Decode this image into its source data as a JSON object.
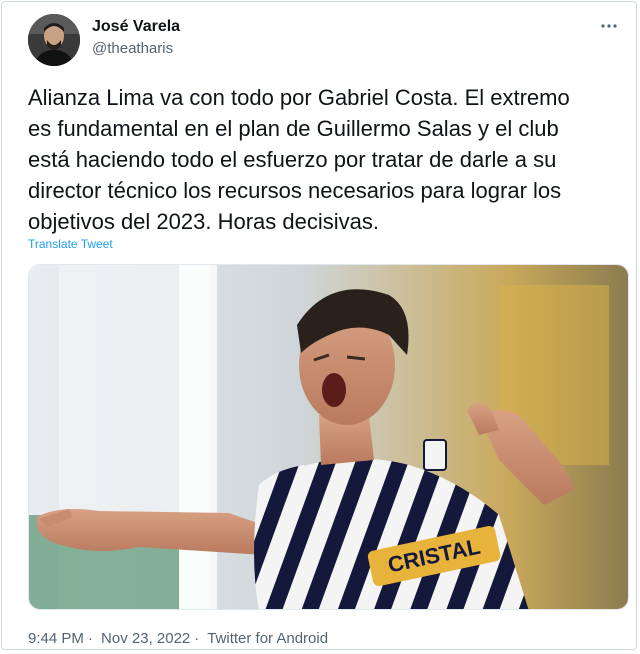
{
  "author": {
    "name": "José Varela",
    "handle": "@theatharis"
  },
  "tweet": {
    "text": "Alianza Lima va con todo por Gabriel Costa. El extremo\nes fundamental en el plan de Guillermo Salas y el club\nestá haciendo todo el esfuerzo por tratar de darle a su\ndirector técnico  los recursos necesarios para lograr los\nobjetivos del 2023. Horas decisivas.",
    "translate_label": "Translate Tweet"
  },
  "media": {
    "jersey_sponsor": "CRISTAL"
  },
  "meta": {
    "time": "9:44 PM",
    "separator": "·",
    "date": "Nov 23, 2022",
    "source": "Twitter for Android"
  },
  "colors": {
    "link": "#1d9bf0",
    "secondary_text": "#536471",
    "primary_text": "#0f1419"
  },
  "icons": {
    "more": "more-icon"
  }
}
